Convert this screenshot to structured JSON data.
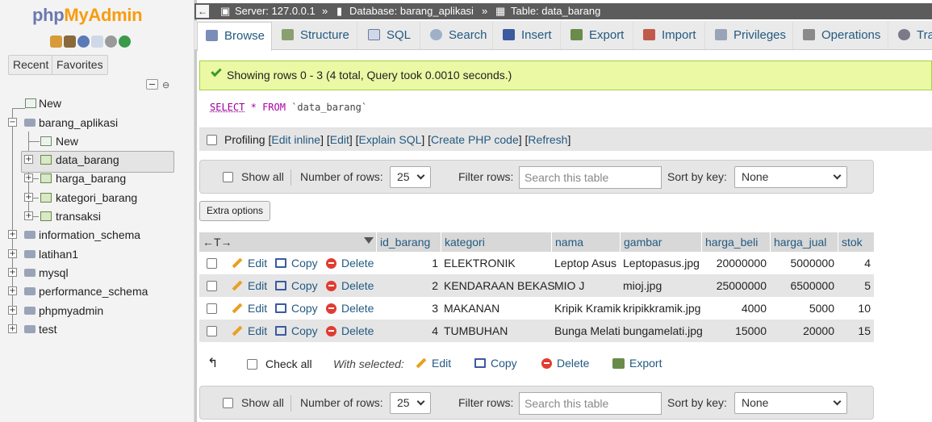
{
  "logo": {
    "part1": "php",
    "part2": "MyAdmin"
  },
  "sidebar": {
    "recent_tab": "Recent",
    "favorites_tab": "Favorites",
    "tree": [
      {
        "label": "New"
      },
      {
        "label": "barang_aplikasi"
      },
      {
        "label": "New"
      },
      {
        "label": "data_barang"
      },
      {
        "label": "harga_barang"
      },
      {
        "label": "kategori_barang"
      },
      {
        "label": "transaksi"
      },
      {
        "label": "information_schema"
      },
      {
        "label": "latihan1"
      },
      {
        "label": "mysql"
      },
      {
        "label": "performance_schema"
      },
      {
        "label": "phpmyadmin"
      },
      {
        "label": "test"
      }
    ]
  },
  "breadcrumb": {
    "server": "Server: 127.0.0.1",
    "database": "Database: barang_aplikasi",
    "table": "Table: data_barang",
    "sep": "»"
  },
  "tabs": [
    {
      "label": "Browse"
    },
    {
      "label": "Structure"
    },
    {
      "label": "SQL"
    },
    {
      "label": "Search"
    },
    {
      "label": "Insert"
    },
    {
      "label": "Export"
    },
    {
      "label": "Import"
    },
    {
      "label": "Privileges"
    },
    {
      "label": "Operations"
    },
    {
      "label": "Tra"
    }
  ],
  "message": "Showing rows 0 - 3 (4 total, Query took 0.0010 seconds.)",
  "query": {
    "select": "SELECT",
    "star": "*",
    "from": "FROM",
    "table": "`data_barang`"
  },
  "profiling": {
    "label": "Profiling",
    "open": "[",
    "close": "]",
    "links": [
      "Edit inline",
      "Edit",
      "Explain SQL",
      "Create PHP code",
      "Refresh"
    ]
  },
  "navigation": {
    "show_all": "Show all",
    "number_of_rows_label": "Number of rows:",
    "number_of_rows_value": "25",
    "filter_label": "Filter rows:",
    "filter_placeholder": "Search this table",
    "sort_label": "Sort by key:",
    "sort_value": "None"
  },
  "extra_options": "Extra options",
  "table": {
    "arrows": "←T→",
    "columns": [
      "id_barang",
      "kategori",
      "nama",
      "gambar",
      "harga_beli",
      "harga_jual",
      "stok"
    ],
    "actions": {
      "edit": "Edit",
      "copy": "Copy",
      "delete": "Delete"
    },
    "rows": [
      {
        "id": "1",
        "kategori": "ELEKTRONIK",
        "nama": "Leptop Asus",
        "gambar": "Leptopasus.jpg",
        "harga_beli": "20000000",
        "harga_jual": "5000000",
        "stok": "4"
      },
      {
        "id": "2",
        "kategori": "KENDARAAN BEKAS",
        "nama": "MIO J",
        "gambar": "mioj.jpg",
        "harga_beli": "25000000",
        "harga_jual": "6500000",
        "stok": "5"
      },
      {
        "id": "3",
        "kategori": "MAKANAN",
        "nama": "Kripik Kramik",
        "gambar": "kripikkramik.jpg",
        "harga_beli": "4000",
        "harga_jual": "5000",
        "stok": "10"
      },
      {
        "id": "4",
        "kategori": "TUMBUHAN",
        "nama": "Bunga Melati",
        "gambar": "bungamelati.jpg",
        "harga_beli": "15000",
        "harga_jual": "20000",
        "stok": "15"
      }
    ]
  },
  "bulk": {
    "check_all": "Check all",
    "with_selected": "With selected:",
    "edit": "Edit",
    "copy": "Copy",
    "delete": "Delete",
    "export": "Export"
  },
  "colors": {
    "topbar": "#5c5c5c",
    "link": "#235a81",
    "success_bg": "#ebf8a4",
    "success_border": "#a2d246"
  }
}
